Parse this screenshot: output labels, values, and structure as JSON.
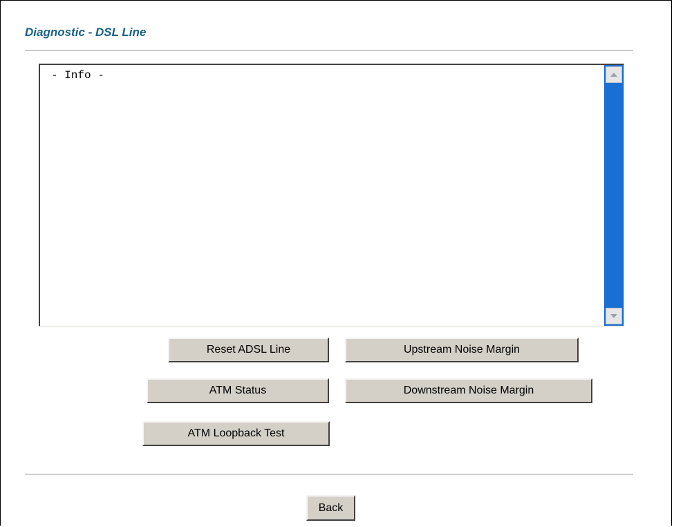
{
  "page": {
    "title": "Diagnostic - DSL Line"
  },
  "info_box": {
    "text": "- Info -"
  },
  "buttons": {
    "reset_adsl_line": "Reset ADSL Line",
    "upstream_noise_margin": "Upstream Noise Margin",
    "atm_status": "ATM Status",
    "downstream_noise_margin": "Downstream Noise Margin",
    "atm_loopback_test": "ATM Loopback Test",
    "back": "Back"
  },
  "icons": {
    "scroll_up": "chevron-up-icon",
    "scroll_down": "chevron-down-icon"
  },
  "colors": {
    "title": "#1a5f86",
    "scrollbar_track": "#1a6fd4",
    "button_face": "#d4d0c8"
  }
}
